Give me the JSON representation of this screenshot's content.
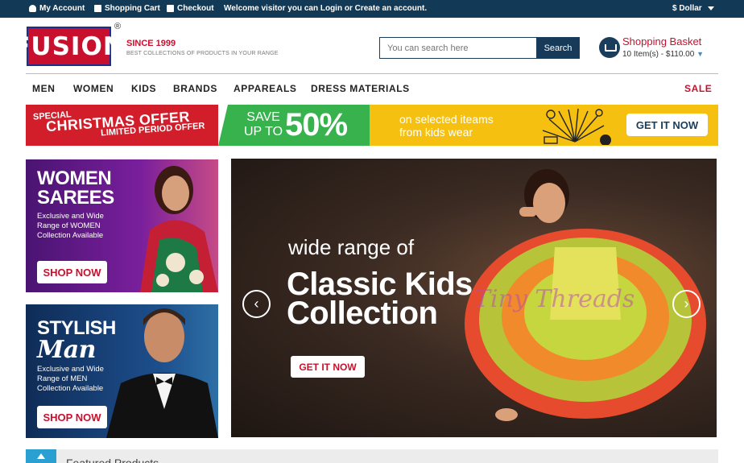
{
  "topbar": {
    "my_account": "My Account",
    "shopping_cart": "Shopping Cart",
    "checkout": "Checkout",
    "welcome": "Welcome visitor you can Login or Create an account.",
    "currency": "$ Dollar"
  },
  "header": {
    "logo_text": "FUSION",
    "registered": "®",
    "since": "SINCE 1999",
    "tagline": "BEST COLLECTIONS OF PRODUCTS IN YOUR RANGE",
    "search_placeholder": "You can search here",
    "search_button": "Search",
    "basket_title": "Shopping Basket",
    "basket_items": "10 Item(s) - $110.00",
    "basket_caret": "▼"
  },
  "nav": {
    "items": [
      "MEN",
      "WOMEN",
      "KIDS",
      "BRANDS",
      "APPAREALS",
      "DRESS MATERIALS"
    ],
    "sale": "SALE"
  },
  "promo": {
    "special": "SPECIAL",
    "christmas": "CHRISTMAS OFFER",
    "limited": "LIMITED PERIOD OFFER",
    "save": "SAVE",
    "upto": "UP TO",
    "percent": "50%",
    "selected_line1": "on selected iteams",
    "selected_line2": "from kids wear",
    "cta": "GET IT NOW"
  },
  "side_women": {
    "title_line1": "WOMEN",
    "title_line2": "SAREES",
    "desc": "Exclusive and Wide Range of WOMEN Collection Available",
    "cta": "SHOP NOW"
  },
  "side_men": {
    "title_line1": "STYLISH",
    "title_line2": "Man",
    "desc": "Exclusive and Wide Range of MEN Collection Available",
    "cta": "SHOP NOW"
  },
  "slider": {
    "subtitle": "wide range of",
    "title_line1": "Classic Kids",
    "title_line2": "Collection",
    "cta": "GET IT NOW",
    "watermark": "Tiny Threads",
    "prev_icon": "‹",
    "next_icon": "›"
  },
  "featured": {
    "label": "Featured Products"
  },
  "colors": {
    "topbar": "#123a57",
    "brand_red": "#c8102e",
    "accent_blue": "#2a9fd1"
  }
}
